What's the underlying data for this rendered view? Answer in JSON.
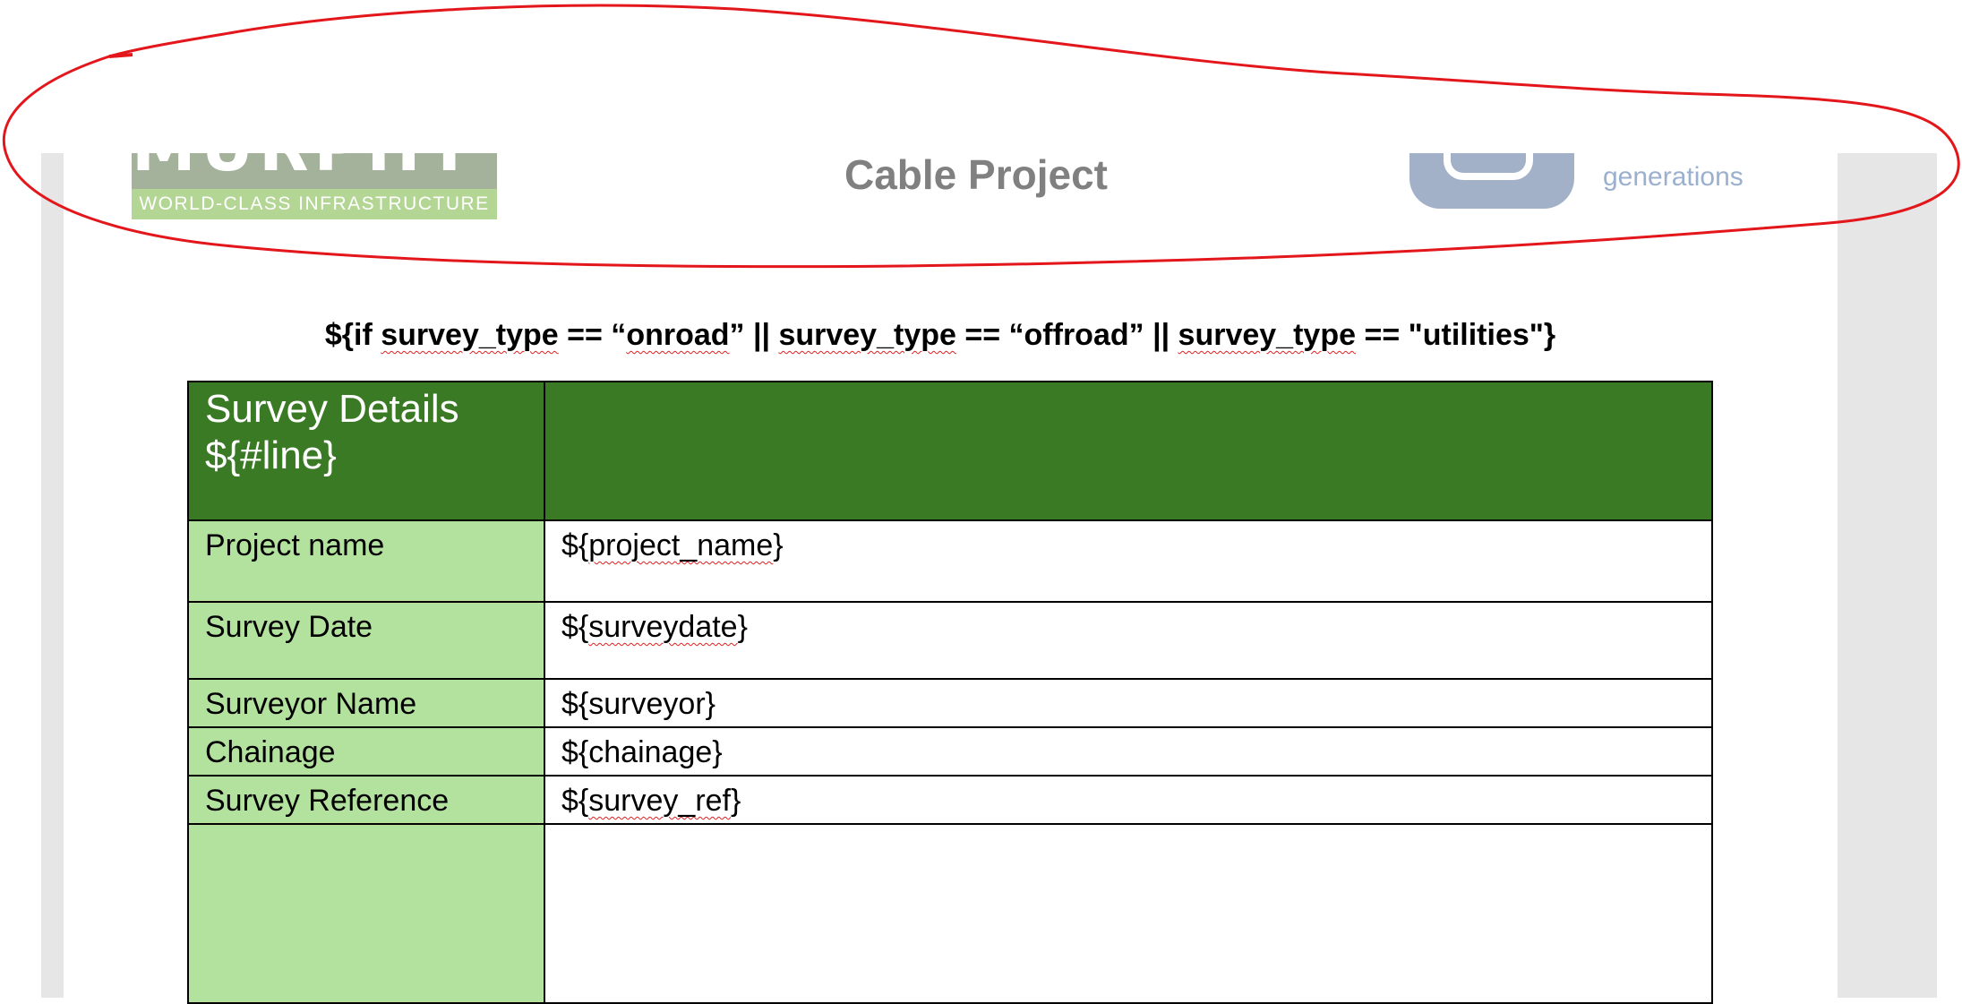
{
  "header": {
    "title": "Cable Project",
    "left_logo": {
      "tagline": "WORLD-CLASS INFRASTRUCTURE",
      "wordmark_partial": "MURPHY"
    },
    "right_logo": {
      "tagline": "generations"
    }
  },
  "condition": {
    "prefix": "${if ",
    "var1": "survey_type",
    "eq1": " == “",
    "val1": "onroad",
    "sep1": "” || ",
    "var2": "survey_type",
    "eq2": " == “offroad” || ",
    "var3": "survey_type",
    "suffix": " == \"utilities\"}"
  },
  "table": {
    "header_label_line1": "Survey Details",
    "header_label_line2": "${#line}",
    "rows": [
      {
        "label": "Project name",
        "value_prefix": "${",
        "value_word": "project_name",
        "value_suffix": "}"
      },
      {
        "label": "Survey Date",
        "value_prefix": "${",
        "value_word": "surveydate",
        "value_suffix": "}"
      },
      {
        "label": "Surveyor Name",
        "value": "${surveyor}"
      },
      {
        "label": "Chainage",
        "value": "${chainage}"
      },
      {
        "label": "Survey Reference",
        "value_prefix": "${",
        "value_word": "survey_ref",
        "value_suffix": "}"
      }
    ]
  },
  "colors": {
    "header_green": "#3b7a24",
    "label_green": "#b3e29f",
    "annotation_red": "#e3161b",
    "title_gray": "#808080"
  }
}
